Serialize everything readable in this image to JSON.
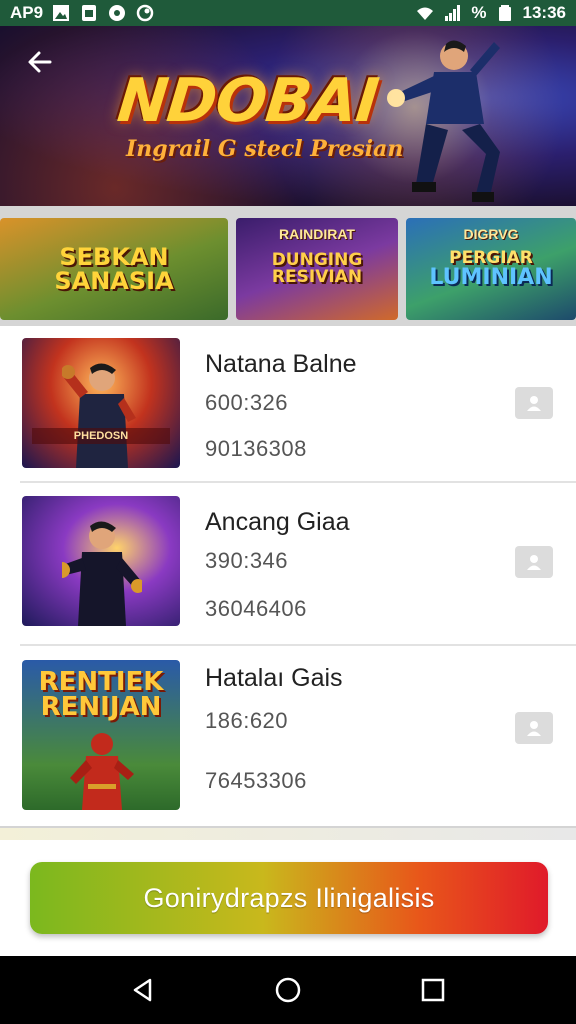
{
  "status_bar": {
    "carrier_label": "AP9",
    "battery_percent": "%",
    "time": "13:36",
    "icons": [
      "image-icon",
      "sim-icon",
      "record-icon",
      "sync-icon",
      "wifi-icon",
      "signal-icon",
      "battery-icon"
    ]
  },
  "hero": {
    "title": "NDOBAI",
    "subtitle": "Ingrail G stecl Presian",
    "back_icon": "arrow-left-icon"
  },
  "banners": [
    {
      "text_line1": "SEBKAN",
      "text_line2": "SANASIA"
    },
    {
      "top_label": "RAINDIRAT",
      "text_line1": "DUNGING",
      "text_line2": "RESIVIAN"
    },
    {
      "top_label": "DIGRVG",
      "text_line1": "PERGIAR",
      "text_line2": "LUMINIAN"
    }
  ],
  "list": {
    "items": [
      {
        "name": "Natana Balne",
        "line1": "600:326",
        "line2": "90136308",
        "thumb_label": "PHEDOSN",
        "action_icon": "person-icon"
      },
      {
        "name": "Ancang Giaa",
        "line1": "390:346",
        "line2": "36046406",
        "action_icon": "person-icon"
      },
      {
        "name": "Hatalaı Gais",
        "line1": "186:620",
        "line2": "76453306",
        "thumb_title_line1": "RENTIEK",
        "thumb_title_line2": "RENIJAN",
        "action_icon": "person-icon"
      }
    ]
  },
  "cta": {
    "label": "Gonirydrapzs Ilinigalisis"
  },
  "nav": {
    "back_icon": "triangle-back-icon",
    "home_icon": "circle-home-icon",
    "recents_icon": "square-recents-icon"
  },
  "colors": {
    "status_bar": "#1f5a3a",
    "cta_start": "#7bb81e",
    "cta_end": "#e01a2a",
    "title_yellow": "#ffd23a"
  }
}
